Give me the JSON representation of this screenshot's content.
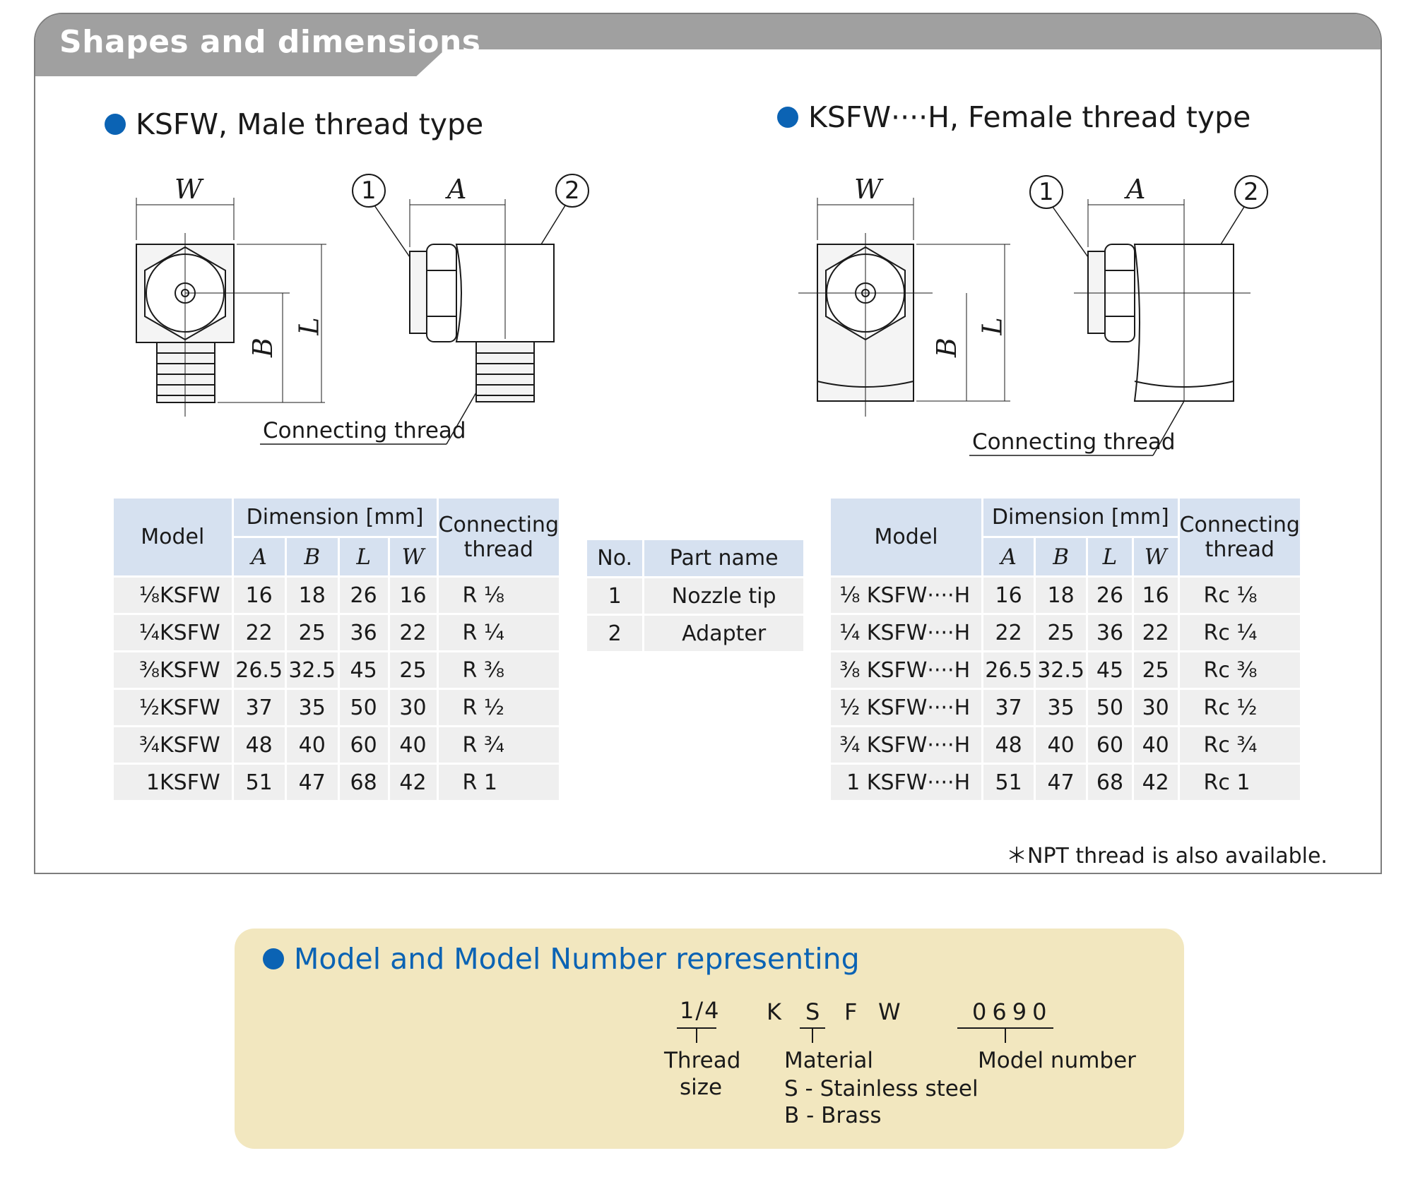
{
  "panel": {
    "title": "Shapes and dimensions"
  },
  "male": {
    "heading": "KSFW, Male thread type",
    "drawing": {
      "dim_w": "W",
      "dim_a": "A",
      "dim_b": "B",
      "dim_l": "L",
      "callout_1": "1",
      "callout_2": "2",
      "connecting_thread": "Connecting thread"
    },
    "table": {
      "model_header": "Model",
      "dimension_header": "Dimension [mm]",
      "connecting_header_1": "Connecting",
      "connecting_header_2": "thread",
      "cols": [
        "A",
        "B",
        "L",
        "W"
      ],
      "rows": [
        {
          "model": "⅛KSFW",
          "a": "16",
          "b": "18",
          "l": "26",
          "w": "16",
          "thread": "R ⅛"
        },
        {
          "model": "¼KSFW",
          "a": "22",
          "b": "25",
          "l": "36",
          "w": "22",
          "thread": "R ¼"
        },
        {
          "model": "⅜KSFW",
          "a": "26.5",
          "b": "32.5",
          "l": "45",
          "w": "25",
          "thread": "R ⅜"
        },
        {
          "model": "½KSFW",
          "a": "37",
          "b": "35",
          "l": "50",
          "w": "30",
          "thread": "R ½"
        },
        {
          "model": "¾KSFW",
          "a": "48",
          "b": "40",
          "l": "60",
          "w": "40",
          "thread": "R ¾"
        },
        {
          "model": "1KSFW",
          "a": "51",
          "b": "47",
          "l": "68",
          "w": "42",
          "thread": "R 1"
        }
      ]
    }
  },
  "parts": {
    "no_header": "No.",
    "name_header": "Part name",
    "rows": [
      {
        "no": "1",
        "name": "Nozzle tip"
      },
      {
        "no": "2",
        "name": "Adapter"
      }
    ]
  },
  "female": {
    "heading": "KSFW····H, Female thread type",
    "drawing": {
      "dim_w": "W",
      "dim_a": "A",
      "dim_b": "B",
      "dim_l": "L",
      "callout_1": "1",
      "callout_2": "2",
      "connecting_thread": "Connecting thread"
    },
    "table": {
      "model_header": "Model",
      "dimension_header": "Dimension [mm]",
      "connecting_header_1": "Connecting",
      "connecting_header_2": "thread",
      "cols": [
        "A",
        "B",
        "L",
        "W"
      ],
      "rows": [
        {
          "model": "⅛ KSFW····H",
          "a": "16",
          "b": "18",
          "l": "26",
          "w": "16",
          "thread": "Rc ⅛"
        },
        {
          "model": "¼ KSFW····H",
          "a": "22",
          "b": "25",
          "l": "36",
          "w": "22",
          "thread": "Rc ¼"
        },
        {
          "model": "⅜ KSFW····H",
          "a": "26.5",
          "b": "32.5",
          "l": "45",
          "w": "25",
          "thread": "Rc ⅜"
        },
        {
          "model": "½ KSFW····H",
          "a": "37",
          "b": "35",
          "l": "50",
          "w": "30",
          "thread": "Rc ½"
        },
        {
          "model": "¾ KSFW····H",
          "a": "48",
          "b": "40",
          "l": "60",
          "w": "40",
          "thread": "Rc ¾"
        },
        {
          "model": "1 KSFW····H",
          "a": "51",
          "b": "47",
          "l": "68",
          "w": "42",
          "thread": "Rc 1"
        }
      ]
    },
    "note": "＊NPT thread is also available."
  },
  "model_number": {
    "heading": "Model and Model Number representing",
    "code_size": "1/4",
    "code_k": "K",
    "code_s": "S",
    "code_f": "F",
    "code_w": "W",
    "code_number": "0690",
    "thread_label_1": "Thread",
    "thread_label_2": "size",
    "material_label": "Material",
    "material_s": "S - Stainless steel",
    "material_b": "B - Brass",
    "model_number_label": "Model number"
  },
  "colors": {
    "accent_blue": "#0b63b4",
    "header_gray": "#a0a0a0",
    "table_header": "#d6e1f0",
    "table_row": "#efefef",
    "beige_box": "#f2e7bf"
  }
}
